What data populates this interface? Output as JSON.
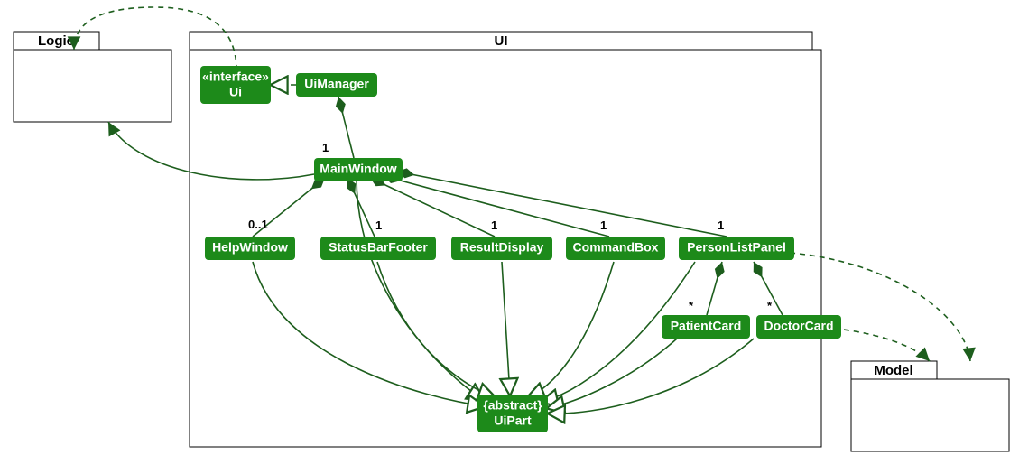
{
  "packages": {
    "logic": {
      "label": "Logic"
    },
    "ui": {
      "label": "UI"
    },
    "model": {
      "label": "Model"
    }
  },
  "nodes": {
    "uiInterface": {
      "line1": "«interface»",
      "line2": "Ui"
    },
    "uiManager": {
      "label": "UiManager"
    },
    "mainWindow": {
      "label": "MainWindow"
    },
    "helpWindow": {
      "label": "HelpWindow"
    },
    "statusBarFooter": {
      "label": "StatusBarFooter"
    },
    "resultDisplay": {
      "label": "ResultDisplay"
    },
    "commandBox": {
      "label": "CommandBox"
    },
    "personListPanel": {
      "label": "PersonListPanel"
    },
    "patientCard": {
      "label": "PatientCard"
    },
    "doctorCard": {
      "label": "DoctorCard"
    },
    "uiPart": {
      "line1": "{abstract}",
      "line2": "UiPart"
    }
  },
  "multiplicities": {
    "mw_from_uimgr": "1",
    "hw_from_mw": "0..1",
    "sbf_from_mw": "1",
    "rd_from_mw": "1",
    "cb_from_mw": "1",
    "plp_from_mw": "1",
    "patient_from_plp": "*",
    "doctor_from_plp": "*"
  },
  "chart_data": {
    "type": "uml-class-diagram",
    "packages": [
      "Logic",
      "UI",
      "Model"
    ],
    "classes": [
      {
        "name": "Ui",
        "stereotype": "interface",
        "package": "UI"
      },
      {
        "name": "UiManager",
        "package": "UI"
      },
      {
        "name": "MainWindow",
        "package": "UI"
      },
      {
        "name": "HelpWindow",
        "package": "UI"
      },
      {
        "name": "StatusBarFooter",
        "package": "UI"
      },
      {
        "name": "ResultDisplay",
        "package": "UI"
      },
      {
        "name": "CommandBox",
        "package": "UI"
      },
      {
        "name": "PersonListPanel",
        "package": "UI"
      },
      {
        "name": "PatientCard",
        "package": "UI"
      },
      {
        "name": "DoctorCard",
        "package": "UI"
      },
      {
        "name": "UiPart",
        "stereotype": "abstract",
        "package": "UI"
      }
    ],
    "relations": [
      {
        "from": "UiManager",
        "to": "Ui",
        "type": "realization"
      },
      {
        "from": "UiManager",
        "to": "MainWindow",
        "type": "composition",
        "multTo": "1"
      },
      {
        "from": "MainWindow",
        "to": "HelpWindow",
        "type": "composition",
        "multTo": "0..1"
      },
      {
        "from": "MainWindow",
        "to": "StatusBarFooter",
        "type": "composition",
        "multTo": "1"
      },
      {
        "from": "MainWindow",
        "to": "ResultDisplay",
        "type": "composition",
        "multTo": "1"
      },
      {
        "from": "MainWindow",
        "to": "CommandBox",
        "type": "composition",
        "multTo": "1"
      },
      {
        "from": "MainWindow",
        "to": "PersonListPanel",
        "type": "composition",
        "multTo": "1"
      },
      {
        "from": "PersonListPanel",
        "to": "PatientCard",
        "type": "composition",
        "multTo": "*"
      },
      {
        "from": "PersonListPanel",
        "to": "DoctorCard",
        "type": "composition",
        "multTo": "*"
      },
      {
        "from": "MainWindow",
        "to": "UiPart",
        "type": "generalization"
      },
      {
        "from": "HelpWindow",
        "to": "UiPart",
        "type": "generalization"
      },
      {
        "from": "StatusBarFooter",
        "to": "UiPart",
        "type": "generalization"
      },
      {
        "from": "ResultDisplay",
        "to": "UiPart",
        "type": "generalization"
      },
      {
        "from": "CommandBox",
        "to": "UiPart",
        "type": "generalization"
      },
      {
        "from": "PersonListPanel",
        "to": "UiPart",
        "type": "generalization"
      },
      {
        "from": "PatientCard",
        "to": "UiPart",
        "type": "generalization"
      },
      {
        "from": "DoctorCard",
        "to": "UiPart",
        "type": "generalization"
      },
      {
        "from": "Ui",
        "to": "Logic",
        "type": "dependency"
      },
      {
        "from": "MainWindow",
        "to": "Logic",
        "type": "dependency"
      },
      {
        "from": "DoctorCard",
        "to": "Model",
        "type": "dependency"
      },
      {
        "from": "PersonListPanel",
        "to": "Model",
        "type": "dependency"
      }
    ]
  }
}
